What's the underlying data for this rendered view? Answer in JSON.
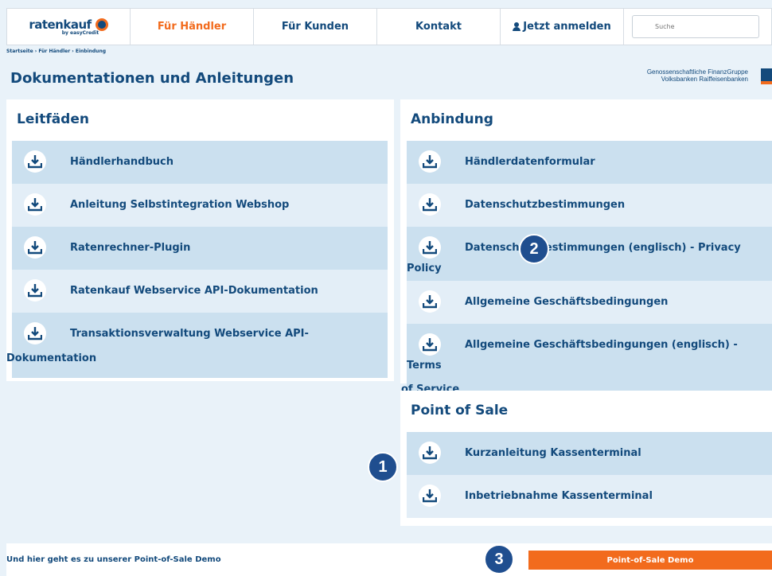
{
  "nav": {
    "logo_text": "ratenkauf",
    "logo_sub": "by easyCredit",
    "haendler": "Für Händler",
    "kunden": "Für Kunden",
    "kontakt": "Kontakt",
    "login": "Jetzt anmelden",
    "search_placeholder": "Suche"
  },
  "breadcrumb": "Startseite › Für Händler › Einbindung",
  "page_title": "Dokumentationen und Anleitungen",
  "brand": {
    "line1": "Genossenschaftliche FinanzGruppe",
    "line2": "Volksbanken Raiffeisenbanken"
  },
  "leitfaeden": {
    "title": "Leitfäden",
    "items": [
      "Händlerhandbuch",
      "Anleitung Selbstintegration Webshop",
      "Ratenrechner-Plugin",
      "Ratenkauf Webservice API-Dokumentation",
      "Transaktionsverwaltung Webservice API-",
      "Dokumentation"
    ]
  },
  "anbindung": {
    "title": "Anbindung",
    "items": [
      "Händlerdatenformular",
      "Datenschutzbestimmungen",
      "Datenschutzbestimmungen (englisch) - Privacy Policy",
      "Allgemeine Geschäftsbedingungen",
      "Allgemeine Geschäftsbedingungen (englisch) - Terms",
      "of Service"
    ]
  },
  "pos": {
    "title": "Point of Sale",
    "items": [
      "Kurzanleitung Kassenterminal",
      "Inbetriebnahme Kassenterminal"
    ]
  },
  "bottom": {
    "text": "Und hier geht es zu unserer Point-of-Sale Demo",
    "button": "Point-of-Sale Demo"
  },
  "badges": [
    "1",
    "2",
    "3"
  ],
  "colors": {
    "primary": "#134a7c",
    "accent": "#f26b1d",
    "row_dark": "#cbe0ef",
    "row_light": "#e3eef7",
    "badge": "#1f4e8f"
  }
}
